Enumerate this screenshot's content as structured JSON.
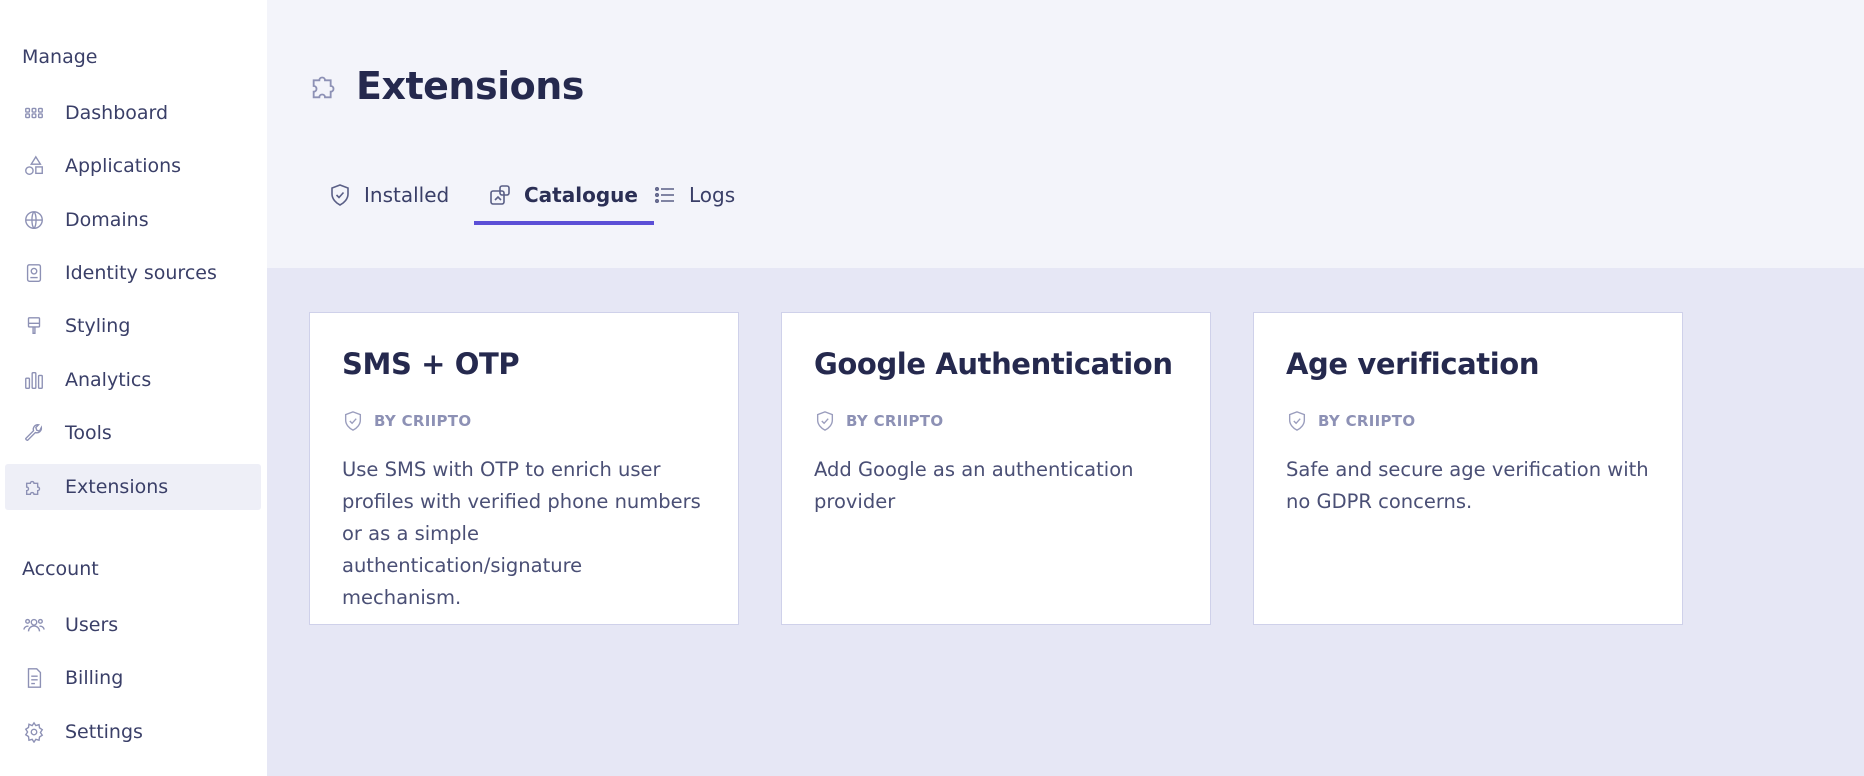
{
  "sidebar": {
    "manage_title": "Manage",
    "account_title": "Account",
    "manage_items": [
      {
        "label": "Dashboard",
        "icon": "dashboard-icon"
      },
      {
        "label": "Applications",
        "icon": "shapes-icon"
      },
      {
        "label": "Domains",
        "icon": "globe-icon"
      },
      {
        "label": "Identity sources",
        "icon": "id-card-icon"
      },
      {
        "label": "Styling",
        "icon": "brush-icon"
      },
      {
        "label": "Analytics",
        "icon": "bar-chart-icon"
      },
      {
        "label": "Tools",
        "icon": "wrench-icon"
      },
      {
        "label": "Extensions",
        "icon": "puzzle-icon",
        "active": true
      }
    ],
    "account_items": [
      {
        "label": "Users",
        "icon": "users-icon"
      },
      {
        "label": "Billing",
        "icon": "receipt-icon"
      },
      {
        "label": "Settings",
        "icon": "gear-icon"
      }
    ]
  },
  "header": {
    "title": "Extensions",
    "title_icon": "puzzle-icon"
  },
  "tabs": [
    {
      "label": "Installed",
      "icon": "shield-check-icon"
    },
    {
      "label": "Catalogue",
      "icon": "catalogue-icon",
      "active": true
    },
    {
      "label": "Logs",
      "icon": "list-icon"
    }
  ],
  "cards": [
    {
      "title": "SMS + OTP",
      "by": "BY CRIIPTO",
      "description": "Use SMS with OTP to enrich user profiles with verified phone numbers or as a simple authentication/signature mechanism."
    },
    {
      "title": "Google Authentication",
      "by": "BY CRIIPTO",
      "description": "Add Google as an authentication provider"
    },
    {
      "title": "Age verification",
      "by": "BY CRIIPTO",
      "description": "Safe and secure age verification with no GDPR concerns."
    }
  ],
  "colors": {
    "accent": "#5b4fd6",
    "content_bg": "#e6e7f5",
    "header_bg": "#f3f4fa"
  }
}
